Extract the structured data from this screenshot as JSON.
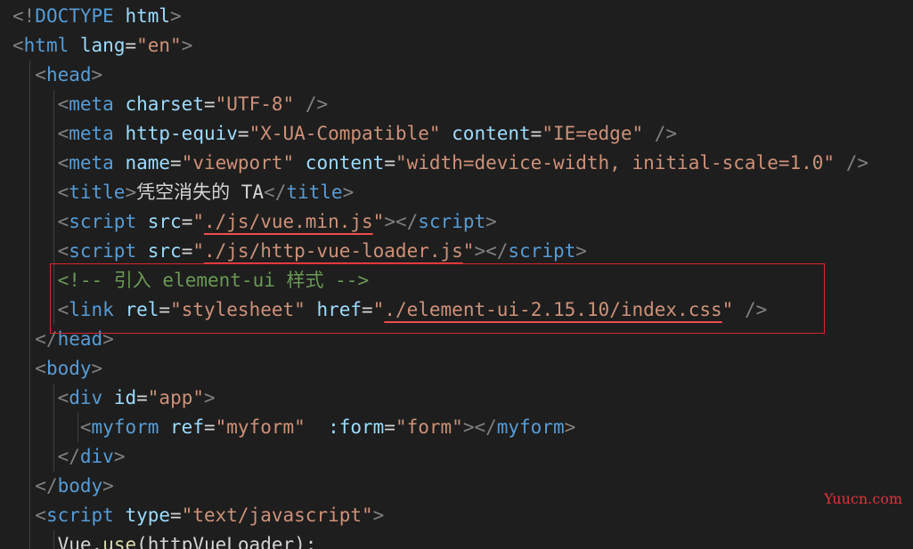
{
  "colors": {
    "background": "#1e1e1e",
    "punct": "#808080",
    "tag": "#569cd6",
    "attr": "#9cdcfe",
    "string": "#ce9178",
    "text": "#d4d4d4",
    "comment": "#6a9955",
    "func": "#dcdcaa",
    "highlight_box": "#d9272e",
    "squiggle": "#f14c4c",
    "watermark": "#e0323a"
  },
  "lines": [
    [
      [
        "punct",
        "<!"
      ],
      [
        "tag",
        "DOCTYPE"
      ],
      [
        "text",
        " "
      ],
      [
        "attr",
        "html"
      ],
      [
        "punct",
        ">"
      ]
    ],
    [
      [
        "punct",
        "<"
      ],
      [
        "tag",
        "html"
      ],
      [
        "text",
        " "
      ],
      [
        "attr",
        "lang"
      ],
      [
        "text",
        "="
      ],
      [
        "string",
        "\"en\""
      ],
      [
        "punct",
        ">"
      ]
    ],
    [
      [
        "text",
        "  "
      ],
      [
        "punct",
        "<"
      ],
      [
        "tag",
        "head"
      ],
      [
        "punct",
        ">"
      ]
    ],
    [
      [
        "text",
        "    "
      ],
      [
        "punct",
        "<"
      ],
      [
        "tag",
        "meta"
      ],
      [
        "text",
        " "
      ],
      [
        "attr",
        "charset"
      ],
      [
        "text",
        "="
      ],
      [
        "string",
        "\"UTF-8\""
      ],
      [
        "text",
        " "
      ],
      [
        "punct",
        "/>"
      ]
    ],
    [
      [
        "text",
        "    "
      ],
      [
        "punct",
        "<"
      ],
      [
        "tag",
        "meta"
      ],
      [
        "text",
        " "
      ],
      [
        "attr",
        "http-equiv"
      ],
      [
        "text",
        "="
      ],
      [
        "string",
        "\"X-UA-Compatible\""
      ],
      [
        "text",
        " "
      ],
      [
        "attr",
        "content"
      ],
      [
        "text",
        "="
      ],
      [
        "string",
        "\"IE=edge\""
      ],
      [
        "text",
        " "
      ],
      [
        "punct",
        "/>"
      ]
    ],
    [
      [
        "text",
        "    "
      ],
      [
        "punct",
        "<"
      ],
      [
        "tag",
        "meta"
      ],
      [
        "text",
        " "
      ],
      [
        "attr",
        "name"
      ],
      [
        "text",
        "="
      ],
      [
        "string",
        "\"viewport\""
      ],
      [
        "text",
        " "
      ],
      [
        "attr",
        "content"
      ],
      [
        "text",
        "="
      ],
      [
        "string",
        "\"width=device-width, initial-scale=1.0\""
      ],
      [
        "text",
        " "
      ],
      [
        "punct",
        "/>"
      ]
    ],
    [
      [
        "text",
        "    "
      ],
      [
        "punct",
        "<"
      ],
      [
        "tag",
        "title"
      ],
      [
        "punct",
        ">"
      ],
      [
        "text",
        "凭空消失的 TA"
      ],
      [
        "punct",
        "</"
      ],
      [
        "tag",
        "title"
      ],
      [
        "punct",
        ">"
      ]
    ],
    [
      [
        "text",
        "    "
      ],
      [
        "punct",
        "<"
      ],
      [
        "tag",
        "script"
      ],
      [
        "text",
        " "
      ],
      [
        "attr",
        "src"
      ],
      [
        "text",
        "="
      ],
      [
        "string",
        "\""
      ],
      [
        "string-squiggle",
        "./js/vue.min.js"
      ],
      [
        "string",
        "\""
      ],
      [
        "punct",
        "></"
      ],
      [
        "tag",
        "script"
      ],
      [
        "punct",
        ">"
      ]
    ],
    [
      [
        "text",
        "    "
      ],
      [
        "punct",
        "<"
      ],
      [
        "tag",
        "script"
      ],
      [
        "text",
        " "
      ],
      [
        "attr",
        "src"
      ],
      [
        "text",
        "="
      ],
      [
        "string",
        "\""
      ],
      [
        "string-squiggle",
        "./js/http-vue-loader.js"
      ],
      [
        "string",
        "\""
      ],
      [
        "punct",
        "></"
      ],
      [
        "tag",
        "script"
      ],
      [
        "punct",
        ">"
      ]
    ],
    [
      [
        "text",
        "    "
      ],
      [
        "comment",
        "<!-- 引入 element-ui 样式 -->"
      ]
    ],
    [
      [
        "text",
        "    "
      ],
      [
        "punct",
        "<"
      ],
      [
        "tag",
        "link"
      ],
      [
        "text",
        " "
      ],
      [
        "attr",
        "rel"
      ],
      [
        "text",
        "="
      ],
      [
        "string",
        "\"stylesheet\""
      ],
      [
        "text",
        " "
      ],
      [
        "attr",
        "href"
      ],
      [
        "text",
        "="
      ],
      [
        "string",
        "\""
      ],
      [
        "string-squiggle",
        "./element-ui-2.15.10/index.css"
      ],
      [
        "string",
        "\""
      ],
      [
        "text",
        " "
      ],
      [
        "punct",
        "/>"
      ]
    ],
    [
      [
        "text",
        "  "
      ],
      [
        "punct",
        "</"
      ],
      [
        "tag",
        "head"
      ],
      [
        "punct",
        ">"
      ]
    ],
    [
      [
        "text",
        "  "
      ],
      [
        "punct",
        "<"
      ],
      [
        "tag",
        "body"
      ],
      [
        "punct",
        ">"
      ]
    ],
    [
      [
        "text",
        "    "
      ],
      [
        "punct",
        "<"
      ],
      [
        "tag",
        "div"
      ],
      [
        "text",
        " "
      ],
      [
        "attr",
        "id"
      ],
      [
        "text",
        "="
      ],
      [
        "string",
        "\"app\""
      ],
      [
        "punct",
        ">"
      ]
    ],
    [
      [
        "text",
        "      "
      ],
      [
        "punct",
        "<"
      ],
      [
        "tag",
        "myform"
      ],
      [
        "text",
        " "
      ],
      [
        "attr",
        "ref"
      ],
      [
        "text",
        "="
      ],
      [
        "string",
        "\"myform\""
      ],
      [
        "text",
        "  "
      ],
      [
        "attr",
        ":form"
      ],
      [
        "text",
        "="
      ],
      [
        "string",
        "\"form\""
      ],
      [
        "punct",
        "></"
      ],
      [
        "tag",
        "myform"
      ],
      [
        "punct",
        ">"
      ]
    ],
    [
      [
        "text",
        "    "
      ],
      [
        "punct",
        "</"
      ],
      [
        "tag",
        "div"
      ],
      [
        "punct",
        ">"
      ]
    ],
    [
      [
        "text",
        "  "
      ],
      [
        "punct",
        "</"
      ],
      [
        "tag",
        "body"
      ],
      [
        "punct",
        ">"
      ]
    ],
    [
      [
        "text",
        "  "
      ],
      [
        "punct",
        "<"
      ],
      [
        "tag",
        "script"
      ],
      [
        "text",
        " "
      ],
      [
        "attr",
        "type"
      ],
      [
        "text",
        "="
      ],
      [
        "string",
        "\"text/javascript\""
      ],
      [
        "punct",
        ">"
      ]
    ],
    [
      [
        "text",
        "    "
      ],
      [
        "text",
        "Vue"
      ],
      [
        "text",
        "."
      ],
      [
        "func",
        "use"
      ],
      [
        "text",
        "("
      ],
      [
        "text",
        "httpVueLoader"
      ],
      [
        "text",
        ");"
      ]
    ]
  ],
  "watermark": "Yuucn.com"
}
